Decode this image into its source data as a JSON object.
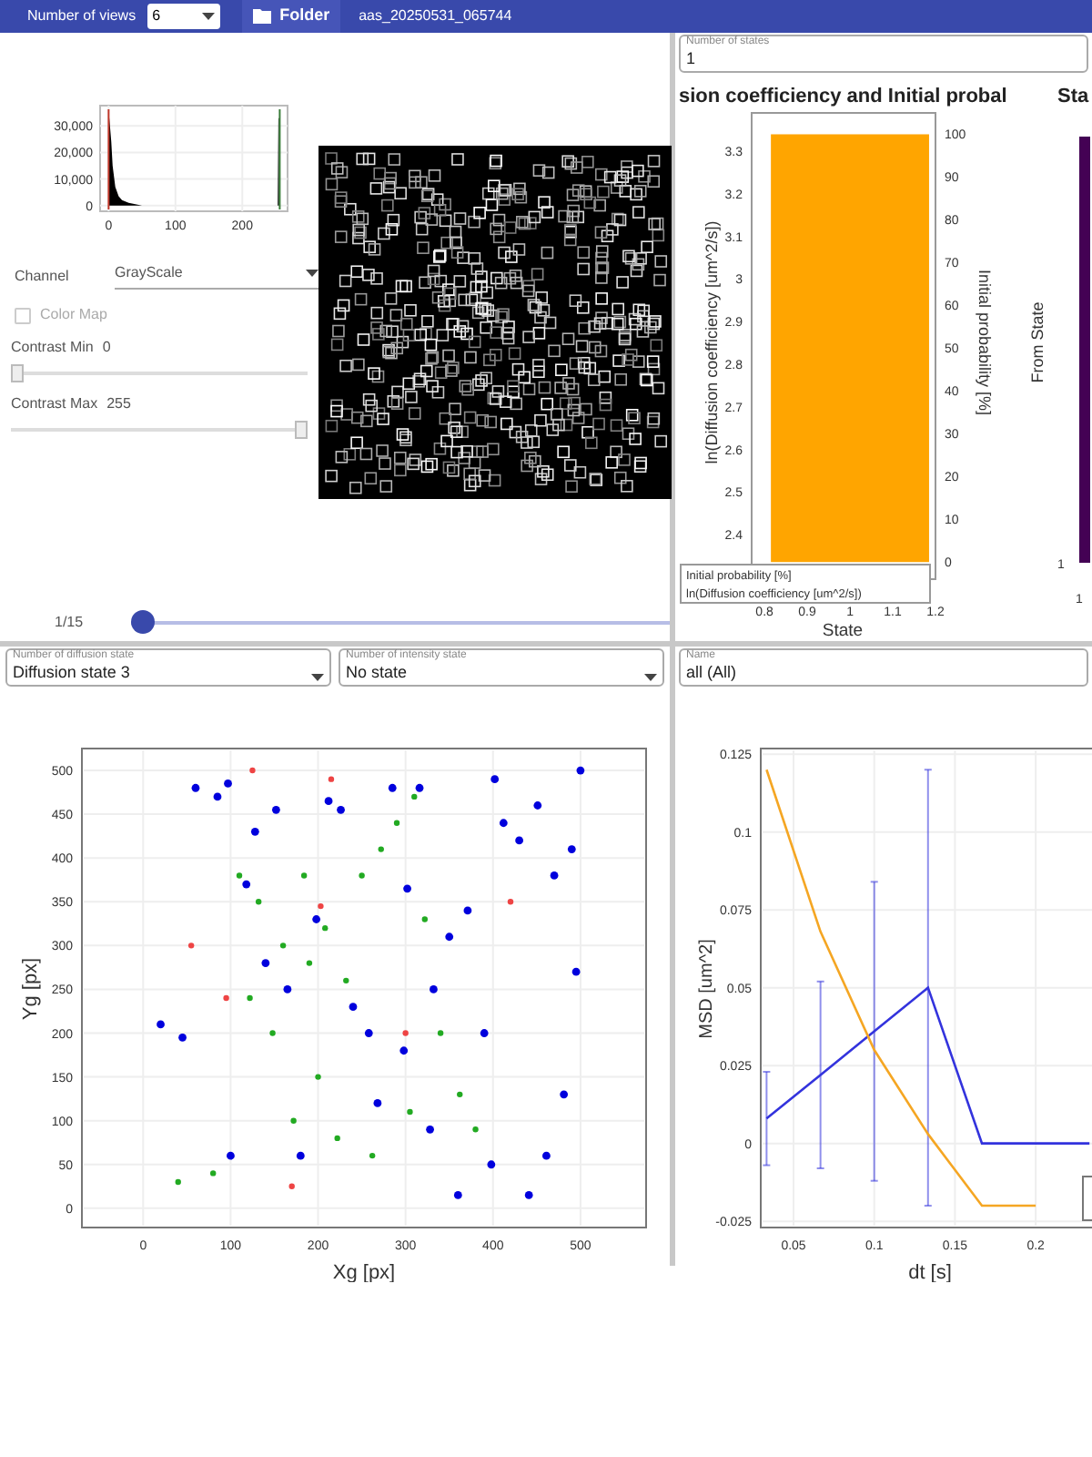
{
  "toolbar": {
    "views_label": "Number of views",
    "views_value": "6",
    "folder_button": "Folder",
    "file_name": "aas_20250531_065744"
  },
  "image_panel": {
    "histogram": {
      "chart_data": {
        "type": "area",
        "x": [
          0,
          1,
          2,
          4,
          6,
          10,
          15,
          20,
          30,
          50,
          100,
          150,
          200,
          250,
          253,
          254,
          255
        ],
        "series": [
          {
            "color": "#000000",
            "values": [
              35000,
              33000,
              30000,
              24000,
              15000,
              7000,
              3500,
              2000,
              1000,
              0,
              0,
              0,
              0,
              0,
              0,
              33000,
              33000
            ]
          }
        ],
        "ref_lines": [
          {
            "axis": "x",
            "value": 0,
            "color": "#c0392b"
          },
          {
            "axis": "x",
            "value": 256,
            "color": "#3a7d3a"
          }
        ],
        "grid": true,
        "xlim": [
          -10,
          265
        ],
        "ylim": [
          -1500,
          37000
        ],
        "xticks": [
          0,
          100,
          200
        ],
        "yticks": [
          {
            "value": 0,
            "label": "0"
          },
          {
            "value": 10000,
            "label": "10,000"
          },
          {
            "value": 20000,
            "label": "20,000"
          },
          {
            "value": 30000,
            "label": "30,000"
          }
        ]
      }
    },
    "channel": {
      "label": "Channel",
      "value": "GrayScale"
    },
    "color_map": {
      "label": "Color Map",
      "checked": false,
      "disabled": true
    },
    "contrast_min": {
      "label": "Contrast Min",
      "reading": "0",
      "level": 0
    },
    "contrast_max": {
      "label": "Contrast Max",
      "reading": "255",
      "level": 1
    },
    "frame": {
      "reading": "1/15",
      "level": 0
    }
  },
  "states_panel": {
    "number_of_states": {
      "label": "Number of states",
      "value": "1"
    },
    "diffusion_chart": {
      "chart_data": {
        "type": "bar",
        "title": "sion coefficiency and Initial probal",
        "xlabel": "State",
        "ylabel": "Initial probability [%]",
        "x": [
          1
        ],
        "series": [
          {
            "name": "Initial probability [%]",
            "color": "#ffa500",
            "values": [
              100
            ]
          },
          {
            "name": "ln(Diffusion coefficiency [um^2/s])",
            "values": [
              null
            ]
          }
        ],
        "xlim": [
          0.77,
          1.2
        ],
        "ylim": [
          -4,
          105
        ],
        "xticks": [
          0.8,
          0.9,
          1,
          1.1,
          1.2
        ],
        "yticks": [
          0,
          10,
          20,
          30,
          40,
          50,
          60,
          70,
          80,
          90,
          100
        ]
      },
      "left_axis": {
        "label": "ln(Diffusion coefficiency [um^2/s])",
        "ticks": [
          "3.3",
          "3.2",
          "3.1",
          "3",
          "2.9",
          "2.8",
          "2.7",
          "2.6",
          "2.5",
          "2.4"
        ]
      }
    },
    "transition_chart": {
      "title": "Sta",
      "ylabel": "From State",
      "ytick": "1",
      "xtick": "1",
      "color": "#440154"
    }
  },
  "scatter_panel": {
    "diffusion_state": {
      "label": "Number of diffusion state",
      "value": "Diffusion state 3"
    },
    "intensity_state": {
      "label": "Number of intensity state",
      "value": "No state"
    },
    "chart_data": {
      "type": "scatter",
      "xlabel": "Xg [px]",
      "ylabel": "Yg [px]",
      "grid": true,
      "xlim": [
        -70,
        575
      ],
      "ylim": [
        -22,
        525
      ],
      "xticks": [
        0,
        100,
        200,
        300,
        400,
        500
      ],
      "yticks": [
        0,
        50,
        100,
        150,
        200,
        250,
        300,
        350,
        400,
        450,
        500
      ],
      "x": [
        20,
        40,
        45,
        55,
        60,
        80,
        85,
        95,
        97,
        100,
        110,
        118,
        122,
        125,
        128,
        132,
        140,
        148,
        152,
        160,
        165,
        170,
        172,
        180,
        184,
        190,
        198,
        200,
        203,
        208,
        212,
        215,
        222,
        226,
        232,
        240,
        250,
        258,
        262,
        268,
        272,
        285,
        290,
        298,
        300,
        302,
        305,
        310,
        316,
        322,
        328,
        332,
        340,
        350,
        360,
        362,
        371,
        380,
        390,
        398,
        402,
        412,
        420,
        430,
        441,
        451,
        461,
        470,
        481,
        490,
        495,
        500
      ],
      "series": [
        {
          "color": "#0000dd",
          "values": [
            210,
            null,
            195,
            null,
            480,
            null,
            470,
            null,
            485,
            60,
            null,
            370,
            null,
            null,
            430,
            null,
            280,
            null,
            455,
            null,
            250,
            null,
            null,
            60,
            null,
            null,
            330,
            null,
            null,
            null,
            465,
            null,
            null,
            455,
            null,
            230,
            null,
            200,
            null,
            120,
            null,
            480,
            null,
            180,
            null,
            365,
            null,
            null,
            480,
            null,
            90,
            250,
            null,
            310,
            15,
            null,
            340,
            null,
            200,
            50,
            490,
            440,
            null,
            420,
            15,
            460,
            60,
            380,
            130,
            410,
            270,
            500
          ]
        },
        {
          "color": "#22aa22",
          "values": [
            null,
            30,
            null,
            null,
            null,
            40,
            null,
            null,
            null,
            null,
            380,
            null,
            240,
            null,
            null,
            350,
            null,
            200,
            null,
            300,
            null,
            null,
            100,
            null,
            380,
            280,
            null,
            150,
            null,
            320,
            null,
            null,
            80,
            null,
            260,
            null,
            380,
            null,
            60,
            null,
            410,
            null,
            440,
            null,
            null,
            null,
            110,
            470,
            null,
            330,
            null,
            null,
            200,
            null,
            null,
            130,
            null,
            90,
            null,
            null,
            null,
            null,
            null,
            null,
            null,
            null,
            null,
            null,
            null,
            null,
            null,
            null
          ]
        },
        {
          "color": "#ee4444",
          "values": [
            null,
            null,
            null,
            300,
            null,
            null,
            null,
            240,
            null,
            null,
            null,
            null,
            null,
            500,
            null,
            null,
            null,
            null,
            null,
            null,
            null,
            25,
            null,
            null,
            null,
            null,
            null,
            null,
            345,
            null,
            null,
            490,
            null,
            null,
            null,
            null,
            null,
            null,
            null,
            null,
            null,
            null,
            null,
            null,
            200,
            null,
            null,
            null,
            null,
            null,
            null,
            null,
            null,
            null,
            null,
            null,
            null,
            null,
            null,
            null,
            null,
            null,
            350,
            null,
            null,
            null,
            null,
            null,
            null,
            null,
            null,
            null
          ]
        }
      ]
    }
  },
  "msd_panel": {
    "name_field": {
      "label": "Name",
      "value": "all (All)"
    },
    "chart_data": {
      "type": "line",
      "xlabel": "dt [s]",
      "ylabel": "MSD [um^2]",
      "grid": true,
      "x": [
        0.0333,
        0.0667,
        0.1,
        0.1333,
        0.1667,
        0.2,
        0.2333
      ],
      "xlim": [
        0.0297,
        0.236
      ],
      "ylim": [
        -0.027,
        0.1268
      ],
      "xticks": [
        0.05,
        0.1,
        0.15,
        0.2
      ],
      "yticks": [
        -0.025,
        0,
        0.025,
        0.05,
        0.075,
        0.1,
        0.125
      ],
      "series": [
        {
          "color": "#3333dd",
          "values": [
            0.008,
            0.022,
            0.036,
            0.05,
            0,
            0,
            0
          ],
          "errors": [
            0.015,
            0.03,
            0.048,
            0.07,
            null,
            null,
            null
          ]
        },
        {
          "color": "#f5a623",
          "values": [
            0.12,
            0.068,
            0.03,
            0.003,
            -0.02,
            -0.02,
            null
          ]
        }
      ]
    }
  }
}
